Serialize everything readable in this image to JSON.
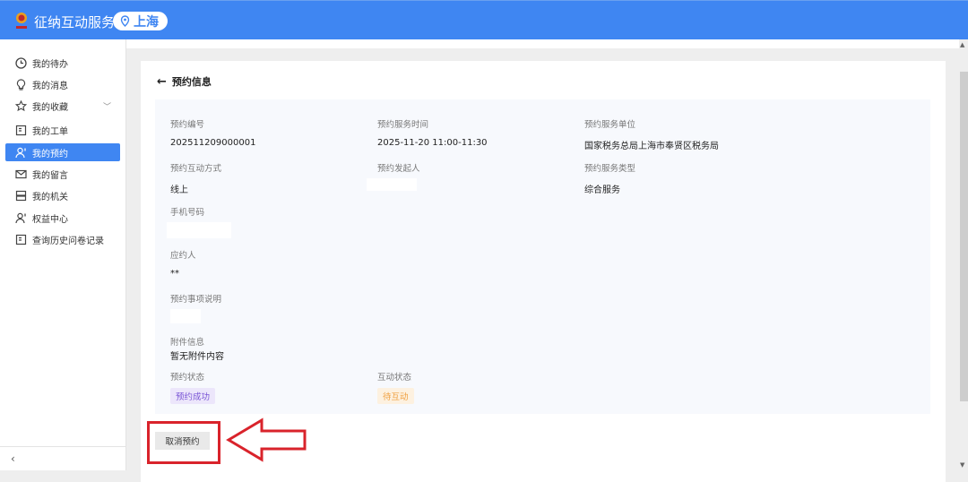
{
  "header": {
    "app_title": "征纳互动服务",
    "city": "上海",
    "brand_color": "#3f86f2"
  },
  "sidebar": {
    "items": [
      {
        "label": "我的待办",
        "icon": "clock-icon"
      },
      {
        "label": "我的消息",
        "icon": "bulb-icon"
      },
      {
        "label": "我的收藏",
        "icon": "star-icon"
      },
      {
        "label": "我的工单",
        "icon": "doc-icon"
      },
      {
        "label": "我的预约",
        "icon": "user-icon"
      },
      {
        "label": "我的留言",
        "icon": "mail-icon"
      },
      {
        "label": "我的机关",
        "icon": "server-icon"
      },
      {
        "label": "权益中心",
        "icon": "user-icon"
      },
      {
        "label": "查询历史问卷记录",
        "icon": "doc-icon"
      }
    ],
    "collapse": "‹"
  },
  "page": {
    "title": "预约信息",
    "fields": {
      "id_label": "预约编号",
      "id": "202511209000001",
      "time_label": "预约服务时间",
      "time": "2025-11-20 11:00-11:30",
      "unit_label": "预约服务单位",
      "unit": "国家税务总局上海市奉贤区税务局",
      "mode_label": "预约互动方式",
      "mode": "线上",
      "initiator_label": "预约发起人",
      "type_label": "预约服务类型",
      "type": "综合服务",
      "phone_label": "手机号码",
      "respondent_label": "应约人",
      "respondent": "**",
      "desc_label": "预约事项说明",
      "attach_label": "附件信息",
      "attach": "暂无附件内容",
      "status_label": "预约状态",
      "status": "预约成功",
      "interact_label": "互动状态",
      "interact": "待互动"
    },
    "cancel_label": "取消预约"
  }
}
